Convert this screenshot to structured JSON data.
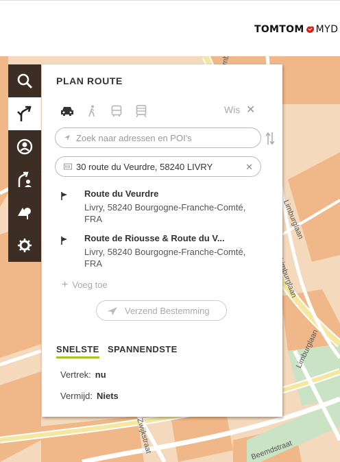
{
  "header": {
    "brand": "TOMTOM",
    "brand_suffix": "MYD"
  },
  "map": {
    "street_labels": [
      "Limburglaan",
      "Limburglaan",
      "Beemdstraat",
      "Zwijkstraat",
      "Limburglaan",
      "Limburglaan"
    ]
  },
  "toolbar": {
    "items": [
      {
        "icon": "search-icon",
        "active": false
      },
      {
        "icon": "route-icon",
        "active": true
      },
      {
        "icon": "my-places-icon",
        "active": false
      },
      {
        "icon": "traffic-route-icon",
        "active": false
      },
      {
        "icon": "poi-icon",
        "active": false
      },
      {
        "icon": "settings-icon",
        "active": false
      }
    ]
  },
  "panel": {
    "title": "PLAN ROUTE",
    "travel_modes": [
      "car-icon",
      "pedestrian-icon",
      "bus-icon",
      "train-icon"
    ],
    "clear_label": "Wis",
    "from_placeholder": "Zoek naar adressen en POI's",
    "to_value": "30 route du Veurdre, 58240 LIVRY",
    "results": [
      {
        "name": "Route du Veurdre",
        "address": "Livry, 58240 Bourgogne-Franche-Comté, FRA"
      },
      {
        "name": "Route de Riousse & Route du V...",
        "address": "Livry, 58240 Bourgogne-Franche-Comté, FRA"
      }
    ],
    "add_label": "Voeg toe",
    "send_label": "Verzend Bestemming",
    "tabs": [
      "SNELSTE",
      "SPANNENDSTE"
    ],
    "options": [
      {
        "label": "Vertrek:",
        "value": "nu"
      },
      {
        "label": "Vermijd:",
        "value": "Niets"
      }
    ]
  },
  "colors": {
    "toolbar_bg": "#3d2e25",
    "tab_accent": "#a6c227",
    "brand_red": "#df1b12",
    "map_bg": "#f5d9bd",
    "map_block": "#f0b888",
    "map_green": "#c9e3c4"
  }
}
